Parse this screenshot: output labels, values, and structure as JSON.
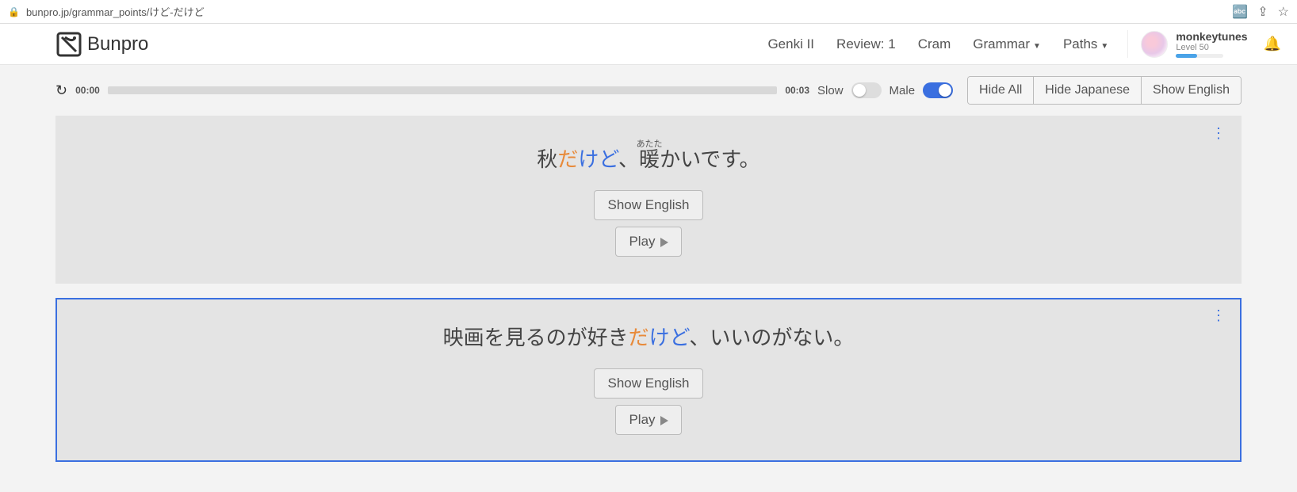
{
  "address_bar": {
    "url": "bunpro.jp/grammar_points/けど-だけど"
  },
  "nav": {
    "brand": "Bunpro",
    "links": {
      "deck": "Genki II",
      "review": "Review: 1",
      "cram": "Cram",
      "grammar": "Grammar",
      "paths": "Paths"
    },
    "user": {
      "name": "monkeytunes",
      "level": "Level 50"
    }
  },
  "audio": {
    "elapsed": "00:00",
    "total": "00:03",
    "slow_label": "Slow",
    "male_label": "Male"
  },
  "buttons": {
    "hide_all": "Hide All",
    "hide_jp": "Hide Japanese",
    "show_en_toolbar": "Show English",
    "show_en": "Show English",
    "play": "Play"
  },
  "sentences": [
    {
      "pre": "秋",
      "da": "だ",
      "kedo": "けど",
      "post_comma": "、",
      "ruby_base": "暖",
      "ruby_rt": "あたた",
      "tail": "かいです。"
    },
    {
      "pre": "映画を見るのが好き",
      "da": "だ",
      "kedo": "けど",
      "post": "、いいのがない。"
    }
  ]
}
